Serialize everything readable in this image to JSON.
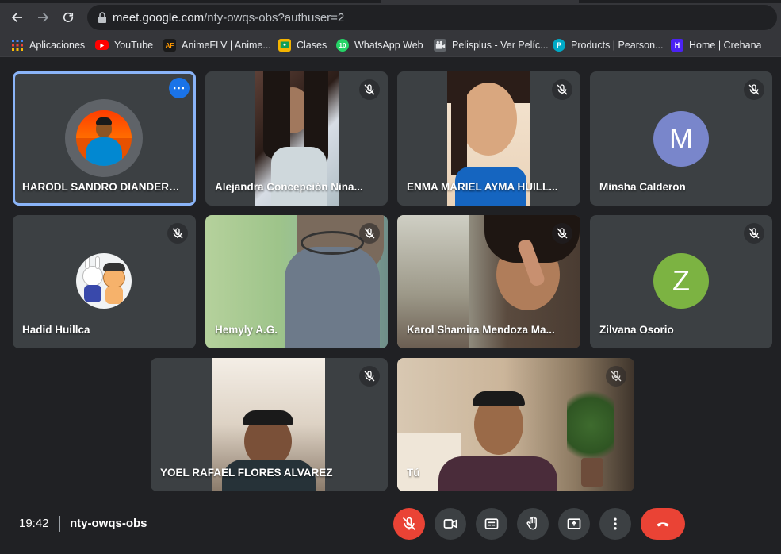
{
  "browser": {
    "url_host": "meet.google.com",
    "url_path": "/nty-owqs-obs?authuser=2",
    "bookmarks": [
      {
        "label": "Aplicaciones",
        "icon": "apps-grid-icon",
        "color": "#4285f4"
      },
      {
        "label": "YouTube",
        "icon": "youtube-icon",
        "color": "#ff0000"
      },
      {
        "label": "AnimeFLV | Anime...",
        "icon": "animeflv-icon",
        "color": "#1a1a1a"
      },
      {
        "label": "Clases",
        "icon": "classroom-icon",
        "color": "#f4b400"
      },
      {
        "label": "WhatsApp Web",
        "icon": "whatsapp-icon",
        "color": "#25d366",
        "badge": "10"
      },
      {
        "label": "Pelisplus - Ver Pelíc...",
        "icon": "pelisplus-icon",
        "color": "#5f6368"
      },
      {
        "label": "Products | Pearson...",
        "icon": "pearson-icon",
        "color": "#00a9c5"
      },
      {
        "label": "Home | Crehana",
        "icon": "crehana-icon",
        "color": "#4b22f4"
      }
    ]
  },
  "participants": [
    {
      "name": "HARODL SANDRO DIANDERA...",
      "kind": "avatar-photo",
      "active": true,
      "muted": false
    },
    {
      "name": "Alejandra Concepción Nina...",
      "kind": "video",
      "muted": true
    },
    {
      "name": "ENMA MARIEL AYMA HUILL...",
      "kind": "video",
      "muted": true
    },
    {
      "name": "Minsha Calderon",
      "kind": "letter",
      "letter": "M",
      "color": "#7986cb",
      "muted": true
    },
    {
      "name": "Hadid Huillca",
      "kind": "avatar-sticker",
      "muted": true
    },
    {
      "name": "Hemyly A.G.",
      "kind": "video",
      "muted": true
    },
    {
      "name": "Karol Shamira Mendoza Ma...",
      "kind": "video",
      "muted": true
    },
    {
      "name": "Zilvana Osorio",
      "kind": "letter",
      "letter": "Z",
      "color": "#7cb342",
      "muted": true
    },
    {
      "name": "YOEL RAFAEL FLORES ALVAREZ",
      "kind": "video",
      "muted": true
    },
    {
      "name": "Tú",
      "kind": "video",
      "muted": false
    }
  ],
  "meeting": {
    "time": "19:42",
    "code": "nty-owqs-obs"
  },
  "colors": {
    "accent": "#1a73e8",
    "danger": "#ea4335",
    "tile": "#3c4043",
    "background": "#202124"
  }
}
